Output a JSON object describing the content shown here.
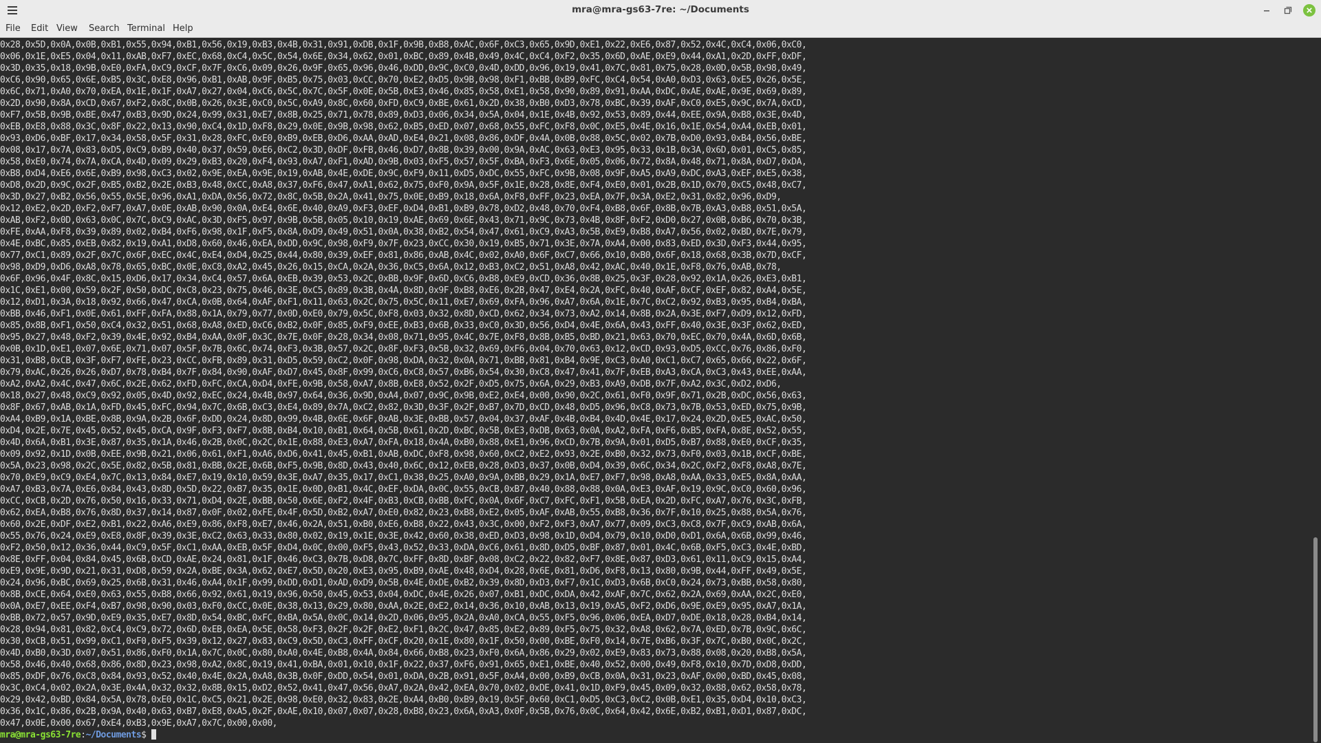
{
  "window": {
    "title": "mra@mra-gs63-7re: ~/Documents"
  },
  "menu": [
    "File",
    "Edit",
    "View",
    "Search",
    "Terminal",
    "Help"
  ],
  "terminal": {
    "lines": [
      "0x28,0x5D,0x0A,0x0B,0xB1,0x55,0x94,0xB1,0x56,0x19,0xB3,0x4B,0x31,0x91,0xDB,0x1F,0x9B,0xB8,0xAC,0x6F,0xC3,0x65,0x9D,0xE1,0x22,0xE6,0x87,0x52,0x4C,0xC4,0x06,0xC0,",
      "0x06,0x1E,0xE5,0x04,0x11,0xAB,0xF7,0xEC,0x68,0xC4,0x5C,0x54,0x6E,0x34,0x62,0x01,0xBC,0x89,0x4B,0x49,0x4C,0xC4,0xF2,0x35,0x6D,0xAE,0xE9,0x44,0xA1,0x2D,0xFF,0xDF,",
      "0x3D,0x35,0x18,0x9B,0xE0,0xFA,0xC9,0xCF,0x7F,0xC6,0x09,0x26,0x9F,0x65,0x96,0x46,0xDD,0x9C,0xC0,0x4D,0xDD,0x96,0x19,0x41,0x7C,0x81,0x75,0x28,0x0D,0x5B,0x98,0x49,",
      "0xC6,0x90,0x65,0x6E,0xB5,0x3C,0xE8,0x96,0xB1,0xAB,0x9F,0xB5,0x75,0x03,0xCC,0x70,0xE2,0xD5,0x9B,0x98,0xF1,0xBB,0xB9,0xFC,0xC4,0x54,0xA0,0xD3,0x63,0xE5,0x26,0x5E,",
      "0x6C,0x71,0xA0,0x70,0xEA,0x1E,0x1F,0xA7,0x27,0x04,0xC6,0x5C,0x7C,0x5F,0x0E,0x5B,0xE3,0x46,0x85,0x58,0xE1,0x58,0x90,0x89,0x91,0xAA,0xDC,0xAE,0xAE,0x9E,0x69,0x89,",
      "0x2D,0x90,0x8A,0xCD,0x67,0xF2,0x8C,0x0B,0x26,0x3E,0xC0,0x5C,0xA9,0x8C,0x60,0xFD,0xC9,0xBE,0x61,0x2D,0x38,0xB0,0xD3,0x78,0xBC,0x39,0xAF,0xC0,0xE5,0x9C,0x7A,0xCD,",
      "0xF7,0x5B,0x9B,0xBE,0x47,0xB3,0x9D,0x24,0x99,0x31,0xE7,0x8B,0x25,0x71,0x78,0x89,0xD3,0x06,0x34,0x5A,0x04,0x1E,0x4B,0x92,0x53,0x89,0x44,0xEE,0x9A,0xB8,0x3E,0x4D,",
      "0xEB,0xE8,0x88,0x3C,0x8F,0x22,0x13,0x90,0xC4,0x1D,0xF8,0x29,0x0E,0x9B,0x98,0x62,0xB5,0xED,0x07,0x68,0x55,0xFC,0xF8,0x0C,0xE5,0x4E,0x16,0x1E,0x54,0xA4,0xEB,0x01,",
      "0x93,0xD6,0xBF,0x17,0x34,0x58,0x5F,0x31,0x28,0xFC,0xE0,0xB9,0xEB,0xD6,0xAA,0xAD,0xE4,0x21,0x08,0x86,0xDF,0x4A,0x0B,0x88,0x5C,0x02,0x7B,0xD0,0x93,0xB4,0x56,0xBE,",
      "0x08,0x17,0x7A,0x83,0xD5,0xC9,0xB9,0x40,0x37,0x59,0xE6,0xC2,0x3D,0xDF,0xFB,0x46,0xD7,0x8B,0x39,0x00,0x9A,0xAC,0x63,0xE3,0x95,0x33,0x1B,0x3A,0x6D,0x01,0xC5,0x85,",
      "0x58,0xE0,0x74,0x7A,0xCA,0x4D,0x09,0x29,0xB3,0x20,0xF4,0x93,0xA7,0xF1,0xAD,0x9B,0x03,0xF5,0x57,0x5F,0xBA,0xF3,0x6E,0x05,0x06,0x72,0x8A,0x48,0x71,0x8A,0xD7,0xDA,",
      "0xB8,0xD4,0xE6,0x6E,0xB9,0x98,0xC3,0x02,0x9E,0xEA,0x9E,0x19,0xAB,0x4E,0xDE,0x9C,0xF9,0x11,0xD5,0xDC,0x55,0xFC,0x9B,0x08,0x9F,0xA5,0xA9,0xDC,0xA3,0xEF,0xE5,0x38,",
      "0xD8,0x2D,0x9C,0x2F,0xB5,0xB2,0x2E,0xB3,0x48,0xCC,0xA8,0x37,0xF6,0x47,0xA1,0x62,0x75,0xF0,0x9A,0x5F,0x1E,0x28,0x8E,0xF4,0xE0,0x01,0x2B,0x1D,0x70,0xC5,0x48,0xC7,",
      "0x3D,0x27,0xB2,0x56,0x55,0x5E,0x96,0xA1,0xDA,0x56,0x72,0x8C,0x5B,0x2A,0x41,0x75,0x0E,0xB9,0x18,0x6A,0xF8,0xFF,0x23,0xEA,0x7F,0x3A,0xE2,0x31,0x82,0x96,0xD9,",
      "0x12,0xE2,0x2D,0xF2,0xF7,0xA7,0x0E,0xAB,0x90,0x0A,0xE4,0x6E,0x40,0xA9,0xF3,0xEF,0xD4,0xB1,0xB9,0x78,0xD2,0x48,0x70,0xF4,0xB8,0x6F,0x8B,0x7B,0xA3,0xB8,0x51,0x5A,",
      "0xAB,0xF2,0x0D,0x63,0x0C,0x7C,0xC9,0xAC,0x3D,0xF5,0x97,0x9B,0x5B,0x05,0x10,0x19,0xAE,0x69,0x6E,0x43,0x71,0x9C,0x73,0x4B,0x8F,0xF2,0xD0,0x27,0x0B,0xB6,0x70,0x3B,",
      "0xFE,0xAA,0xF8,0x39,0x89,0x02,0xB4,0xF6,0x98,0x1F,0xF5,0x8A,0xD9,0x49,0x51,0x0A,0x38,0xB2,0x54,0x47,0x61,0xC9,0xA3,0x5B,0xE9,0xB8,0xA7,0x56,0x02,0xBD,0x7E,0x79,",
      "0x4E,0xBC,0x85,0xEB,0x82,0x19,0xA1,0xD8,0x60,0x46,0xEA,0xDD,0x9C,0x98,0xF9,0x7F,0x23,0xCC,0x30,0x19,0xB5,0x71,0x3E,0x7A,0xA4,0x00,0x83,0xED,0x3D,0xF3,0x44,0x95,",
      "0x77,0xC1,0x89,0x2F,0x7C,0x6F,0xEC,0x4C,0xE4,0xD4,0x25,0x44,0x80,0x39,0xEF,0x81,0x86,0xAB,0x4C,0x02,0xA0,0x6F,0xC7,0x66,0x10,0xB0,0x6F,0x18,0x68,0x3B,0x7D,0xCF,",
      "0x98,0xD9,0xD6,0xA8,0x78,0x65,0xBC,0x0E,0xC8,0xA2,0x45,0x26,0x15,0xCA,0x2A,0x36,0xC5,0x6A,0x12,0xB3,0xC2,0x51,0xA8,0x42,0xAC,0x40,0x1E,0xF8,0x76,0xAB,0x78,",
      "0x6F,0x96,0x4F,0x8C,0x15,0xD6,0x17,0x34,0xC4,0x57,0x6A,0xEB,0x39,0x53,0x2C,0xBB,0x9F,0x6D,0xC6,0xB8,0xE9,0xCD,0x36,0x8B,0x25,0x3F,0x28,0x92,0x1A,0x26,0xE3,0xB1,",
      "0x1C,0xE1,0x00,0x59,0x2F,0x50,0xDC,0xC8,0x23,0x75,0x46,0x3E,0xC5,0x89,0x3B,0x4A,0x8D,0x9F,0xB8,0xE6,0x2B,0x47,0xE4,0x2A,0xFC,0x40,0xAF,0xCF,0xEF,0x82,0xA4,0x5E,",
      "0x12,0xD1,0x3A,0x18,0x92,0x66,0x47,0xCA,0x0B,0x64,0xAF,0xF1,0x11,0x63,0x2C,0x75,0x5C,0x11,0xE7,0x69,0xFA,0x96,0xA7,0x6A,0x1E,0x7C,0xC2,0x92,0xB3,0x95,0xB4,0xBA,",
      "0xBB,0x46,0xF1,0x0E,0x61,0xFF,0xFA,0x88,0x1A,0x79,0x77,0x0D,0xE0,0x79,0x5C,0xF8,0x03,0x32,0x8D,0xCD,0x62,0x34,0x73,0xA2,0x14,0x8B,0x2A,0x3E,0xF7,0xD9,0x12,0xFD,",
      "0x85,0x8B,0xF1,0x50,0xC4,0x32,0x51,0x68,0xA8,0xED,0xC6,0xB2,0x0F,0x85,0xF9,0xEE,0xB3,0x6B,0x33,0xC0,0x3D,0x56,0xD4,0x4E,0x6A,0x43,0xFF,0x40,0x3E,0x3F,0x62,0xED,",
      "0x95,0x27,0x48,0xF2,0x39,0x4E,0x92,0xB4,0xAA,0x0F,0x3C,0x7E,0x0F,0x28,0x34,0x08,0x71,0x95,0x4C,0x7E,0xF8,0x8B,0xB5,0xBD,0x21,0x63,0x70,0xEC,0x70,0x4A,0x6D,0x6B,",
      "0x0B,0x1D,0xE1,0x07,0x6E,0x71,0x07,0x5F,0x7B,0x6C,0x74,0xF3,0x3B,0x57,0x2C,0x8F,0xF3,0x5B,0x32,0x69,0xF6,0x04,0x70,0x63,0x12,0xCD,0x93,0xD5,0xCC,0x76,0x86,0xF0,",
      "0x31,0xB8,0xCB,0x3F,0xF7,0xFE,0x23,0xCC,0xFB,0x89,0x31,0xD5,0x59,0xC2,0x0F,0x98,0xDA,0x32,0x0A,0x71,0xBB,0x81,0xB4,0x9E,0xC3,0xA0,0xC1,0xC7,0x65,0x66,0x22,0x6F,",
      "0x79,0xAC,0x26,0x26,0xD7,0x78,0xB4,0x7F,0x84,0x90,0xAF,0xD7,0x45,0x8F,0x99,0xC6,0xC8,0x57,0xB6,0x54,0x30,0xC8,0x47,0x41,0x7F,0xEB,0xA3,0xCA,0xC3,0x43,0xEE,0xAA,",
      "0xA2,0xA2,0x4C,0x47,0x6C,0x2E,0x62,0xFD,0xFC,0xCA,0xD4,0xFE,0x9B,0x58,0xA7,0x8B,0xE8,0x52,0x2F,0xD5,0x75,0x6A,0x29,0xB3,0xA9,0xDB,0x7F,0xA2,0x3C,0xD2,0xD6,",
      "0x18,0x27,0x48,0xC9,0x92,0x05,0x4D,0x92,0xEC,0x24,0x4B,0x97,0x64,0x36,0x9D,0xA4,0x07,0x9C,0x9B,0xE2,0xE4,0x00,0x90,0x2C,0x61,0xF0,0x9F,0x71,0x2B,0xDC,0x56,0x63,",
      "0x8F,0x67,0xAB,0x1A,0xFD,0x45,0xFC,0x94,0x7C,0x6B,0xC3,0xE4,0x89,0x7A,0xC2,0x82,0x3D,0x3F,0x2F,0xB7,0x7D,0xCD,0x48,0xD5,0x96,0xC8,0x73,0x7B,0x53,0xED,0x75,0x9B,",
      "0xA4,0xB9,0x1A,0xBE,0x8B,0x9A,0x2B,0x6F,0xDD,0x24,0x8D,0x99,0x4B,0x6E,0x6F,0xAB,0x3E,0xBB,0x57,0x04,0x37,0xAF,0x4B,0xB4,0x4D,0x4E,0x17,0x24,0x2D,0xE5,0xAC,0x50,",
      "0xD4,0x2E,0x7E,0x45,0x52,0x45,0xCA,0x9F,0xF3,0xF7,0x8B,0xB4,0x10,0xB1,0x64,0x5B,0x61,0x2D,0xBC,0x5B,0xE3,0xDB,0x63,0x0A,0xA2,0xFA,0xF6,0xB5,0xFA,0x8E,0x52,0x55,",
      "0x4D,0x6A,0xB1,0x3E,0x87,0x35,0x1A,0x46,0x2B,0x0C,0x2C,0x1E,0x88,0xE3,0xA7,0xFA,0x18,0x4A,0xB0,0x88,0xE1,0x96,0xCD,0x7B,0x9A,0x01,0xD5,0xB7,0x88,0xE0,0xCF,0x35,",
      "0x09,0x92,0x1D,0x0B,0xEE,0x9B,0x21,0x06,0x61,0xF1,0xA6,0xD6,0x41,0x45,0xB1,0xAB,0xDC,0xF8,0x98,0x60,0xC2,0xE2,0x93,0x2E,0xB0,0x32,0x73,0xF0,0x03,0x1B,0xCF,0xBE,",
      "0x5A,0x23,0x98,0x2C,0x5E,0x82,0x5B,0x81,0xBB,0x2E,0x6B,0xF5,0x9B,0x8D,0x43,0x40,0x6C,0x12,0xEB,0x28,0xD3,0x37,0x0B,0xD4,0x39,0x6C,0x34,0x2C,0xF2,0xF8,0xA8,0x7E,",
      "0x70,0xE9,0xC9,0xE4,0x7C,0x13,0x84,0xE7,0x19,0x10,0x59,0x3E,0xA7,0x35,0x17,0xC1,0x38,0x25,0xA0,0x9A,0xBB,0x29,0x1A,0xE7,0xF7,0x98,0xA8,0xAA,0x33,0xE5,0x8A,0xAA,",
      "0xA7,0xB3,0x7A,0xE6,0x84,0x43,0x8D,0x5D,0x22,0xB7,0x35,0x1E,0x0D,0xB1,0x4C,0xEF,0xDA,0x0C,0x55,0xCB,0xB7,0x40,0x88,0x88,0x0A,0xE3,0xAF,0x19,0x9C,0xC0,0x60,0x96,",
      "0xCC,0xCB,0x2D,0x76,0x50,0x16,0x33,0x71,0xD4,0x2E,0xBB,0x50,0x6E,0xF2,0x4F,0xB3,0xCB,0xBB,0xFC,0x0A,0x6F,0xC7,0xFC,0xF1,0x5B,0xEA,0x2D,0xFC,0xA7,0x76,0x3C,0xFB,",
      "0x62,0xEA,0xB8,0x76,0x8D,0x37,0x14,0x87,0x0F,0x02,0xFE,0x4F,0x5D,0xB2,0xA7,0xE0,0x82,0x23,0xB8,0xE2,0x05,0xAF,0xAB,0x55,0xB8,0x36,0x7F,0x10,0x25,0x88,0x5A,0x76,",
      "0x60,0x2E,0xDF,0xE2,0xB1,0x22,0xA6,0xE9,0x86,0xF8,0xE7,0x46,0x2A,0x51,0xB0,0xE6,0xB8,0x22,0x43,0x3C,0x00,0xF2,0xF3,0xA7,0x77,0x09,0xC3,0xC8,0x7F,0xC9,0xAB,0x6A,",
      "0x55,0x76,0x24,0xE9,0xE8,0x8F,0x39,0x3E,0xC2,0x63,0x33,0x80,0x02,0x19,0x1E,0x3E,0x42,0x60,0x38,0xED,0xD3,0x98,0x1D,0xD4,0x79,0x10,0xD0,0xD1,0x6A,0x6B,0x99,0x46,",
      "0xF2,0x50,0x12,0x36,0x44,0xC9,0x5F,0xC1,0xAA,0xEB,0x5F,0xD4,0x0C,0x00,0xF5,0x43,0x52,0x33,0xDA,0xC6,0x61,0x8D,0xD5,0xBF,0x87,0x01,0x4C,0x6B,0xF5,0xC3,0x4E,0xBD,",
      "0x8E,0xFF,0x04,0x84,0x45,0x6B,0xCD,0xAE,0x24,0x81,0x1F,0x46,0xC3,0x7B,0xD8,0x7C,0xFF,0x8D,0xBF,0x08,0xC2,0x22,0x82,0xF7,0x8E,0x87,0xD3,0x61,0x11,0xC9,0x15,0xA4,",
      "0xE9,0x9E,0x9D,0x21,0x31,0xD8,0x59,0x2A,0xBE,0x3A,0x62,0xE7,0x5D,0x20,0xE3,0x95,0xB9,0xAE,0x48,0xD4,0x28,0x6E,0x81,0xD6,0xF8,0x13,0x80,0x9B,0x44,0xFF,0x49,0x5E,",
      "0x24,0x96,0xBC,0x69,0x25,0x6B,0x31,0x46,0xA4,0x1F,0x99,0xDD,0xD1,0xAD,0xD9,0x5B,0x4E,0xDE,0xB2,0x39,0x8D,0xD3,0xF7,0x1C,0xD3,0x6B,0xC0,0x24,0x73,0xBB,0x58,0x80,",
      "0x8B,0xCE,0x64,0xE0,0x63,0x55,0xB8,0x66,0x92,0x61,0x19,0x96,0x50,0x45,0x53,0x04,0xDC,0x4E,0x26,0x07,0xB1,0xDC,0xDA,0x42,0xAF,0x7C,0x62,0x2A,0x69,0xAA,0x2C,0xE0,",
      "0x0A,0xE7,0xEE,0xF4,0xB7,0x98,0x90,0x03,0xF0,0xCC,0x0E,0x38,0x13,0x29,0x80,0xAA,0x2E,0xE2,0x14,0x36,0x10,0xAB,0x13,0x19,0xA5,0xF2,0xD6,0x9E,0xE9,0x95,0xA7,0x1A,",
      "0xBB,0x72,0x57,0x9D,0xE9,0x35,0xE7,0x8D,0x54,0xBC,0xFC,0xBA,0x5A,0x0C,0x14,0x2D,0x06,0x95,0x2A,0xA0,0xCA,0x55,0xF5,0x96,0x06,0xEA,0xD7,0xDE,0x18,0x28,0xB4,0x14,",
      "0x28,0x94,0x81,0x82,0xC4,0xC9,0x72,0x6D,0xEB,0xEA,0x5E,0x58,0xF3,0x2F,0x2F,0xE2,0xF1,0x2C,0x47,0x85,0xE2,0x89,0xF5,0x75,0x32,0xA8,0x62,0x7A,0xED,0x7B,0x9C,0x6C,",
      "0x30,0xCB,0x51,0x99,0xC1,0xF0,0xF5,0x39,0x12,0x27,0x83,0xC9,0x5D,0xC3,0xFF,0xCF,0x20,0x1E,0x80,0x1F,0x50,0x00,0xBE,0xF0,0x14,0x7E,0xB6,0x3F,0x7C,0xB0,0x0C,0x2C,",
      "0x4D,0xB0,0x3D,0x07,0x51,0x86,0xF0,0x1A,0x7C,0x0C,0x80,0xA0,0x4E,0xB8,0x4A,0x84,0x66,0xB8,0x23,0xF0,0x6A,0x86,0x29,0x02,0xE9,0x83,0x73,0x88,0x08,0x20,0xB8,0x5A,",
      "0x58,0x46,0x40,0x68,0x86,0x8D,0x23,0x98,0xA2,0x8C,0x19,0x41,0xBA,0x01,0x10,0x1F,0x22,0x37,0xF6,0x91,0x65,0xE1,0xBE,0x40,0x52,0x00,0x49,0xF8,0x10,0x7D,0xD8,0xDD,",
      "0x85,0xDF,0x76,0xC8,0x84,0x93,0x52,0x40,0x4E,0x2A,0xA8,0x3B,0x0F,0xDD,0x54,0x01,0xDA,0x2B,0x91,0x5F,0xA4,0x00,0xB9,0xCB,0x0A,0x31,0x23,0xAF,0x00,0xBD,0x45,0x08,",
      "0x3C,0xC4,0x02,0x2A,0x3E,0x4A,0x32,0x32,0x8B,0x15,0xD2,0x52,0x41,0x47,0x56,0xA7,0x2A,0x42,0xEA,0x70,0x02,0xDE,0x41,0x1D,0xF9,0x45,0x09,0x32,0x88,0x62,0x58,0x78,",
      "0x29,0x42,0xBD,0x84,0x5A,0x78,0xE0,0x1C,0xC5,0x21,0x2E,0x98,0xE0,0x32,0x83,0x2E,0xA4,0xB0,0xB9,0x19,0x5F,0x60,0xC1,0xD5,0xC3,0xC2,0x0B,0xE1,0x35,0xD4,0x10,0xC3,",
      "0x36,0x1C,0x86,0x2B,0x9A,0x40,0x63,0xB7,0xE8,0xA5,0x2F,0xAE,0x10,0x07,0x07,0x28,0xB8,0x23,0x6A,0xA3,0x0F,0x5B,0x76,0x0C,0x64,0x42,0x6E,0xB2,0xB1,0xD1,0x87,0xDC,",
      "0x47,0x0E,0x00,0x67,0xE4,0xB3,0x9E,0xA7,0x7C,0x00,0x00,"
    ],
    "prompt_user": "mra@mra-gs63-7re",
    "prompt_sep": ":",
    "prompt_path": "~/Documents",
    "prompt_symbol": "$ "
  },
  "icons": {
    "menu": "hamburger-menu-icon",
    "minimize": "minimize-icon",
    "maximize": "maximize-icon",
    "close": "close-icon"
  },
  "colors": {
    "titlebar_bg": "#ebebeb",
    "terminal_bg": "#2b2b2b",
    "terminal_fg": "#dcdcdc",
    "prompt_user": "#8ae234",
    "prompt_path": "#6f9be0",
    "close_button": "#7cc240"
  }
}
